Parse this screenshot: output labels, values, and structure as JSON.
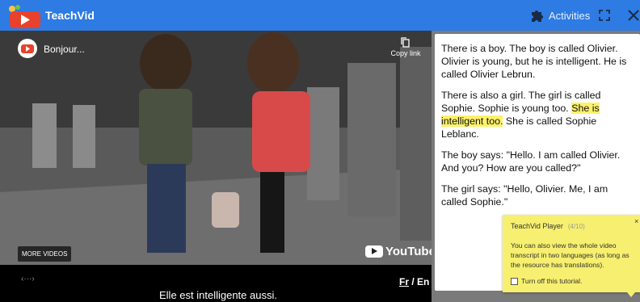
{
  "app": {
    "title": "TeachVid"
  },
  "toolbar": {
    "activities_label": "Activities"
  },
  "video": {
    "title": "Bonjour...",
    "copy_link": "Copy link",
    "more_videos": "MORE VIDEOS",
    "youtube": "YouTube",
    "expand": "‹···›",
    "subtitle": "Elle est intelligente aussi.",
    "lang_fr": "Fr",
    "lang_sep": " / ",
    "lang_en": "En"
  },
  "transcript": {
    "p1": "There is a boy. The boy is called Olivier. Olivier is young, but he is intelligent. He is called Olivier Lebrun.",
    "p2_before": "There is also a girl. The girl is called Sophie. Sophie is young too. ",
    "p2_highlight": "She is intelligent too.",
    "p2_after": " She is called Sophie Leblanc.",
    "p3": "The boy says: \"Hello. I am called Olivier. And you? How are you called?\"",
    "p4": "The girl says: \"Hello, Olivier. Me, I am called Sophie.\""
  },
  "tooltip": {
    "title": "TeachVid Player",
    "step": "(4/10)",
    "close": "×",
    "body": "You can also view the whole video transcript in two languages (as long as the resource has translations).",
    "checkbox_label": "Turn off this tutorial."
  },
  "colors": {
    "topbar": "#2d7be3",
    "highlight": "#fdf16b",
    "tooltip": "#f7ef6f"
  }
}
